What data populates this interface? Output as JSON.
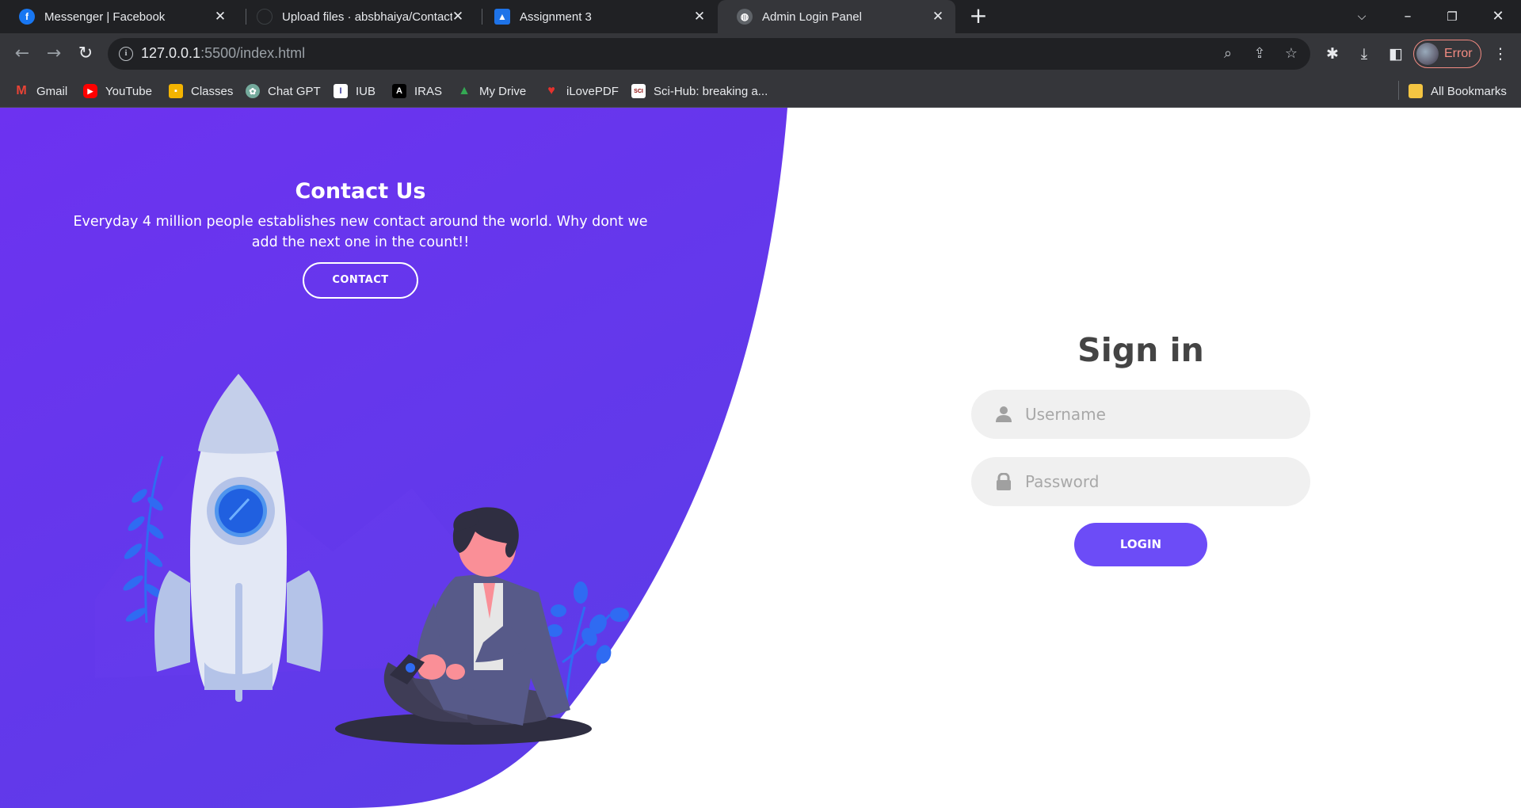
{
  "browser": {
    "tabs": [
      {
        "title": "Messenger | Facebook",
        "icon": "facebook-icon",
        "active": false
      },
      {
        "title": "Upload files · absbhaiya/Contact",
        "icon": "github-icon",
        "active": false
      },
      {
        "title": "Assignment 3",
        "icon": "classroom-icon",
        "active": false
      },
      {
        "title": "Admin Login Panel",
        "icon": "globe-icon",
        "active": true
      }
    ],
    "url_host": "127.0.0.1",
    "url_path": ":5500/index.html",
    "profile_label": "Error",
    "bookmarks": [
      {
        "label": "Gmail",
        "icon": "gmail-icon",
        "color": "#ea4335"
      },
      {
        "label": "YouTube",
        "icon": "youtube-icon",
        "color": "#ff0000"
      },
      {
        "label": "Classes",
        "icon": "classroom-icon",
        "color": "#f4b400"
      },
      {
        "label": "Chat GPT",
        "icon": "chatgpt-icon",
        "color": "#74aa9c"
      },
      {
        "label": "IUB",
        "icon": "iub-icon",
        "color": "#ffffff"
      },
      {
        "label": "IRAS",
        "icon": "iras-icon",
        "color": "#000000"
      },
      {
        "label": "My Drive",
        "icon": "drive-icon",
        "color": "#34a853"
      },
      {
        "label": "iLovePDF",
        "icon": "ilovepdf-icon",
        "color": "#e5322d"
      },
      {
        "label": "Sci-Hub: breaking a...",
        "icon": "scihub-icon",
        "color": "#ffffff"
      }
    ],
    "all_bookmarks": "All Bookmarks"
  },
  "contact": {
    "title": "Contact Us",
    "text": "Everyday 4 million people establishes new contact around the world. Why dont we add the next one in the count!!",
    "button": "CONTACT"
  },
  "signin": {
    "title": "Sign in",
    "username_placeholder": "Username",
    "password_placeholder": "Password",
    "login_button": "LOGIN"
  },
  "colors": {
    "accent": "#6c4cf7",
    "panel_purple": "#6b33f0"
  }
}
